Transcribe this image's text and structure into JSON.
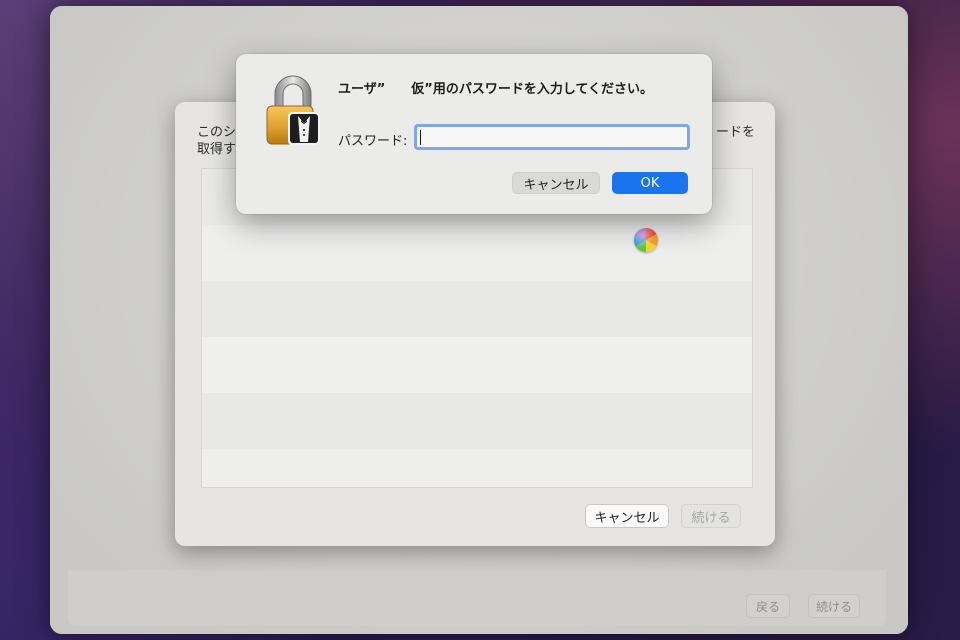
{
  "main_window": {
    "back_label": "戻る",
    "continue_label": "続ける"
  },
  "sheet": {
    "text_line1": "このシ",
    "text_line1_right": "ードを",
    "text_line2": "取得す",
    "cancel_label": "キャンセル",
    "continue_label": "続ける"
  },
  "dialog": {
    "title": "ユーザ”　　仮”用のパスワードを入力してください。",
    "password_label": "パスワード:",
    "password_value": "",
    "cancel_label": "キャンセル",
    "ok_label": "OK"
  },
  "icons": {
    "lock": "lock-icon",
    "spinner": "busy-spinner-icon"
  },
  "colors": {
    "accent": "#1a74f0",
    "focus_ring": "#7fa6e6"
  }
}
